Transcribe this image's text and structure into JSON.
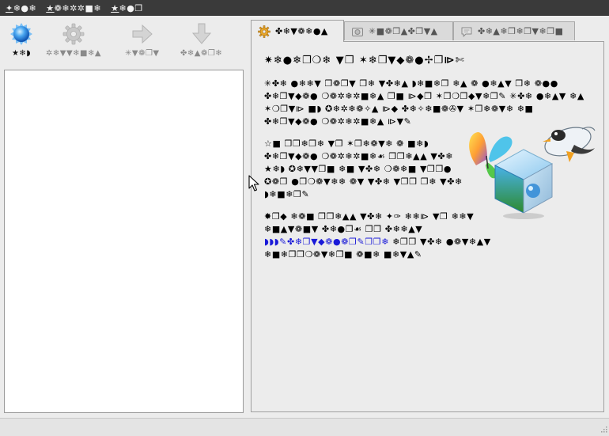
{
  "menubar": {
    "items": [
      {
        "mnemonic": "✦",
        "rest": "❄●❄"
      },
      {
        "mnemonic": "★",
        "rest": "❁❄✲✲■❄"
      },
      {
        "mnemonic": "★",
        "rest": "❄●❐"
      }
    ]
  },
  "toolbar": {
    "buttons": [
      {
        "label": "★❄◗",
        "icon": "new-icon",
        "enabled": true
      },
      {
        "label": "✲❄▼▼❄■❄▲",
        "icon": "settings-icon",
        "enabled": false
      },
      {
        "label": "✳▼❁❐▼",
        "icon": "start-arrow-icon",
        "enabled": false
      },
      {
        "label": "✤❄▲❁❐❄",
        "icon": "discard-arrow-icon",
        "enabled": false
      }
    ]
  },
  "tabs": [
    {
      "label": "✤❄▼❁❄●▲",
      "icon": "gear-icon",
      "active": true
    },
    {
      "label": "✳■❁❐▲✤❐▼▲",
      "icon": "snapshot-icon",
      "active": false
    },
    {
      "label": "✤❄▲❄❐❄❐▼❄❐■",
      "icon": "speech-bubble-icon",
      "active": false
    }
  ],
  "welcome": {
    "title": "✷❄●❄❐❍❄ ▼❐ ✶❄❐▼◆❁●✢❐⧐✄",
    "para1": "✳✤❄ ●❄❄▼ ❐❁❐▼ ❐❄ ▼✤❄▲ ◗❄■❄❐ ❄▲ ❁ ●❄▲▼ ❐❄ ❁●● ✤❄❐▼◆❁● ❍❁✲❄✲■❄▲ ❐■ ⧐◆❐ ✶❐❍❐◆▼❄❐✎ ✳✤❄ ●❄▲▼ ❄▲ ✶❍❐▼⧐ ■◗ ✪❄✲❄❁✧▲ ⧐◆ ✤❄✧❄■❁✇▼ ✶❐❄❁▼❄ ❄■ ✤❄❐▼◆❁● ❍❁✲❄✲■❄▲ ⧐▼✎",
    "para2": "☆■ ❐❐❄❐❄ ▼❐ ✶❐❄❁▼❄ ❁ ■❄◗ ✤❄❐▼◆❁● ❍❁✲❄✲■❄☙ ❐❐❄▲▲ ▼✤❄ ★❄◗ ✪❄▼▼❐■ ❄■ ▼✤❄ ❍❁❄■ ▼❐❐● ✪❁❐ ●❐❍❁▼❄❄ ❁▼ ▼✤❄ ▼❐❐ ❐❄ ▼✤❄ ◗❄■❄❐✎",
    "para3_a": "✸❐◆ ❄❁■ ❐❐❄▲▲ ▼✤❄ ✦✑ ❄❄⧐ ▼❐ ❄❄▼ ❄■▲▼❁■▼ ✤❄●❐☙ ❐❐ ✤❄❄▲▼",
    "para3_link": "◗◗◗✎✤❄❐▼◆❁●❁❐✎❐❐❄",
    "para3_b": "❄❐❐ ▼✤❄ ●❁▼❄▲▼ ❄■❄❐❐❍❁▼❄❐■ ❁■❄ ■❄▼▲✎"
  }
}
